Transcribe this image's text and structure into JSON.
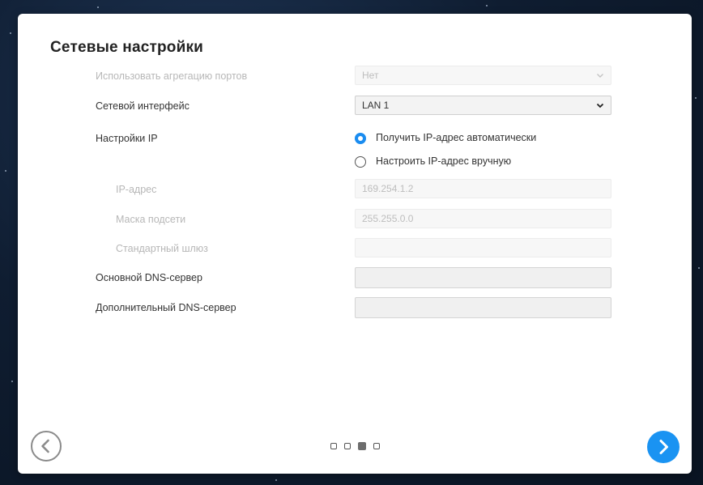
{
  "page": {
    "title": "Сетевые настройки"
  },
  "form": {
    "link_aggregation": {
      "label": "Использовать агрегацию портов",
      "value": "Нет",
      "disabled": true
    },
    "network_interface": {
      "label": "Сетевой интерфейс",
      "value": "LAN 1"
    },
    "ip_settings": {
      "label": "Настройки IP",
      "options": [
        {
          "label": "Получить IP-адрес автоматически",
          "selected": true
        },
        {
          "label": "Настроить IP-адрес вручную",
          "selected": false
        }
      ]
    },
    "ip_address": {
      "label": "IP-адрес",
      "value": "169.254.1.2",
      "disabled": true
    },
    "subnet_mask": {
      "label": "Маска подсети",
      "value": "255.255.0.0",
      "disabled": true
    },
    "gateway": {
      "label": "Стандартный шлюз",
      "value": "",
      "disabled": true
    },
    "primary_dns": {
      "label": "Основной DNS-сервер",
      "value": ""
    },
    "secondary_dns": {
      "label": "Дополнительный DNS-сервер",
      "value": ""
    }
  },
  "pagination": {
    "total": 4,
    "current": 3
  },
  "nav": {
    "prev_icon": "chevron-left-icon",
    "next_icon": "chevron-right-icon"
  },
  "colors": {
    "accent": "#1a93f2",
    "radio_selected": "#1a8cf0",
    "background": "#0f1d31"
  }
}
